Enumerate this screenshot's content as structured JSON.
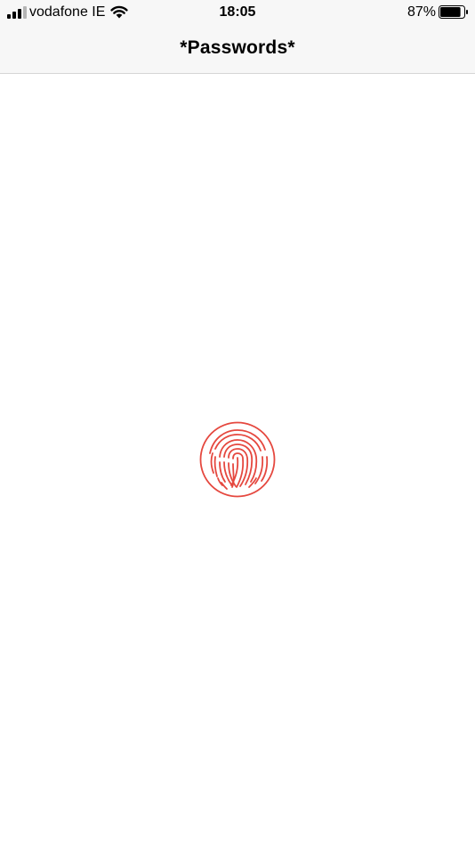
{
  "status_bar": {
    "carrier": "vodafone IE",
    "time": "18:05",
    "battery_percent": "87%",
    "battery_level": 0.87,
    "signal_bars_filled": 3,
    "signal_bars_total": 4,
    "signal_icon": "cellular-signal-icon",
    "wifi_icon": "wifi-icon",
    "battery_icon": "battery-icon"
  },
  "nav": {
    "title": "*Passwords*"
  },
  "unlock": {
    "icon": "touch-id-fingerprint-icon",
    "accent_color": "#e5483f"
  }
}
